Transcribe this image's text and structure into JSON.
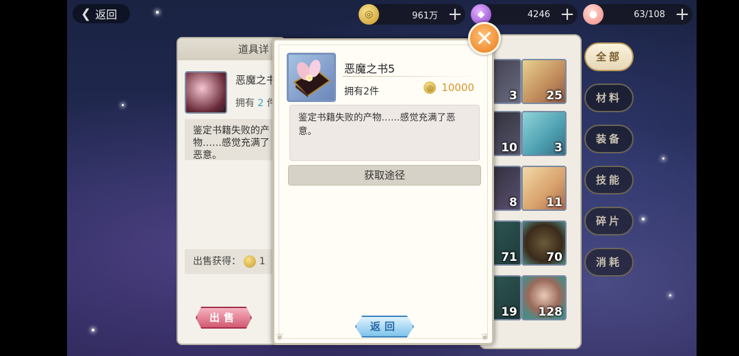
{
  "topbar": {
    "back_label": "返回",
    "resources": [
      {
        "name": "gold",
        "icon": "coin-icon",
        "value": "961万"
      },
      {
        "name": "gem",
        "icon": "gem-icon",
        "value": "4246"
      },
      {
        "name": "stamina",
        "icon": "peach-icon",
        "value": "63/108"
      }
    ]
  },
  "detail_panel": {
    "title": "道具详",
    "item_name": "恶魔之书",
    "owned_prefix": "拥有",
    "owned_count": "2",
    "owned_suffix": "件",
    "description": "鉴定书籍失败的产物……感觉充满了恶意。",
    "sell_label": "出售获得：",
    "sell_value": "1",
    "sell_button": "出售"
  },
  "grid": {
    "cells": [
      {
        "count": "3"
      },
      {
        "count": "25"
      },
      {
        "count": "10"
      },
      {
        "count": "3"
      },
      {
        "count": "8"
      },
      {
        "count": "11"
      },
      {
        "count": "71"
      },
      {
        "count": "70"
      },
      {
        "count": "19"
      },
      {
        "count": "128"
      }
    ]
  },
  "tabs": [
    "全部",
    "材料",
    "装备",
    "技能",
    "碎片",
    "消耗"
  ],
  "dialog": {
    "item_name": "恶魔之书5",
    "owned": "拥有2件",
    "price": "10000",
    "description": "鉴定书籍失败的产物……感觉充满了恶意。",
    "obtain_button": "获取途径",
    "return_button": "返回"
  },
  "colors": {
    "accent_orange": "#ea7a17",
    "price_gold": "#d8952a",
    "owned_count_blue": "#3aa0c8"
  }
}
